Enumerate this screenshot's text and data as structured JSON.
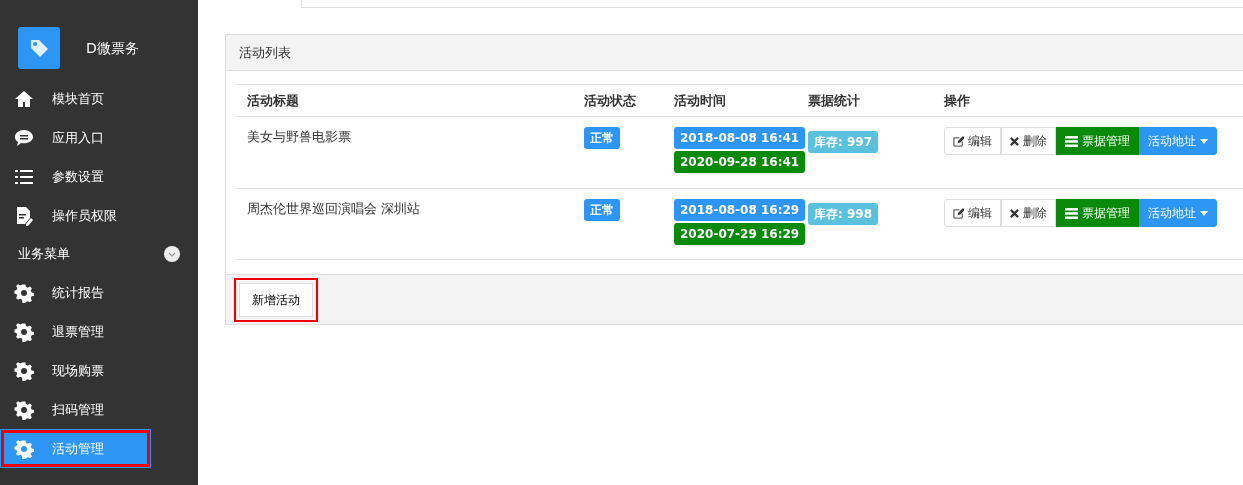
{
  "brand": {
    "name": "D微票务"
  },
  "sidebar": {
    "items": [
      {
        "kind": "home",
        "label": "模块首页",
        "selected": false,
        "highlighted": false
      },
      {
        "kind": "chat",
        "label": "应用入口",
        "selected": false,
        "highlighted": false
      },
      {
        "kind": "list",
        "label": "参数设置",
        "selected": false,
        "highlighted": false
      },
      {
        "kind": "doc",
        "label": "操作员权限",
        "selected": false,
        "highlighted": false
      }
    ],
    "section": {
      "label": "业务菜单",
      "expanded": true
    },
    "section_items": [
      {
        "kind": "gear",
        "label": "统计报告",
        "selected": false,
        "highlighted": false
      },
      {
        "kind": "gear",
        "label": "退票管理",
        "selected": false,
        "highlighted": false
      },
      {
        "kind": "gear",
        "label": "现场购票",
        "selected": false,
        "highlighted": false
      },
      {
        "kind": "gear",
        "label": "扫码管理",
        "selected": false,
        "highlighted": false
      },
      {
        "kind": "gear",
        "label": "活动管理",
        "selected": true,
        "highlighted": true
      }
    ]
  },
  "panel": {
    "title": "活动列表",
    "table": {
      "columns": [
        "活动标题",
        "活动状态",
        "活动时间",
        "票据统计",
        "操作"
      ],
      "rows": [
        {
          "title": "美女与野兽电影票",
          "status": "正常",
          "start": "2018-08-08 16:41",
          "end": "2020-09-28 16:41",
          "stock": "库存: 997",
          "actions": [
            "编辑",
            "删除",
            "票据管理",
            "活动地址"
          ]
        },
        {
          "title": "周杰伦世界巡回演唱会 深圳站",
          "status": "正常",
          "start": "2018-08-08 16:29",
          "end": "2020-07-29 16:29",
          "stock": "库存: 998",
          "actions": [
            "编辑",
            "删除",
            "票据管理",
            "活动地址"
          ]
        }
      ]
    },
    "footer_button": {
      "label": "新增活动",
      "highlighted": true
    }
  }
}
